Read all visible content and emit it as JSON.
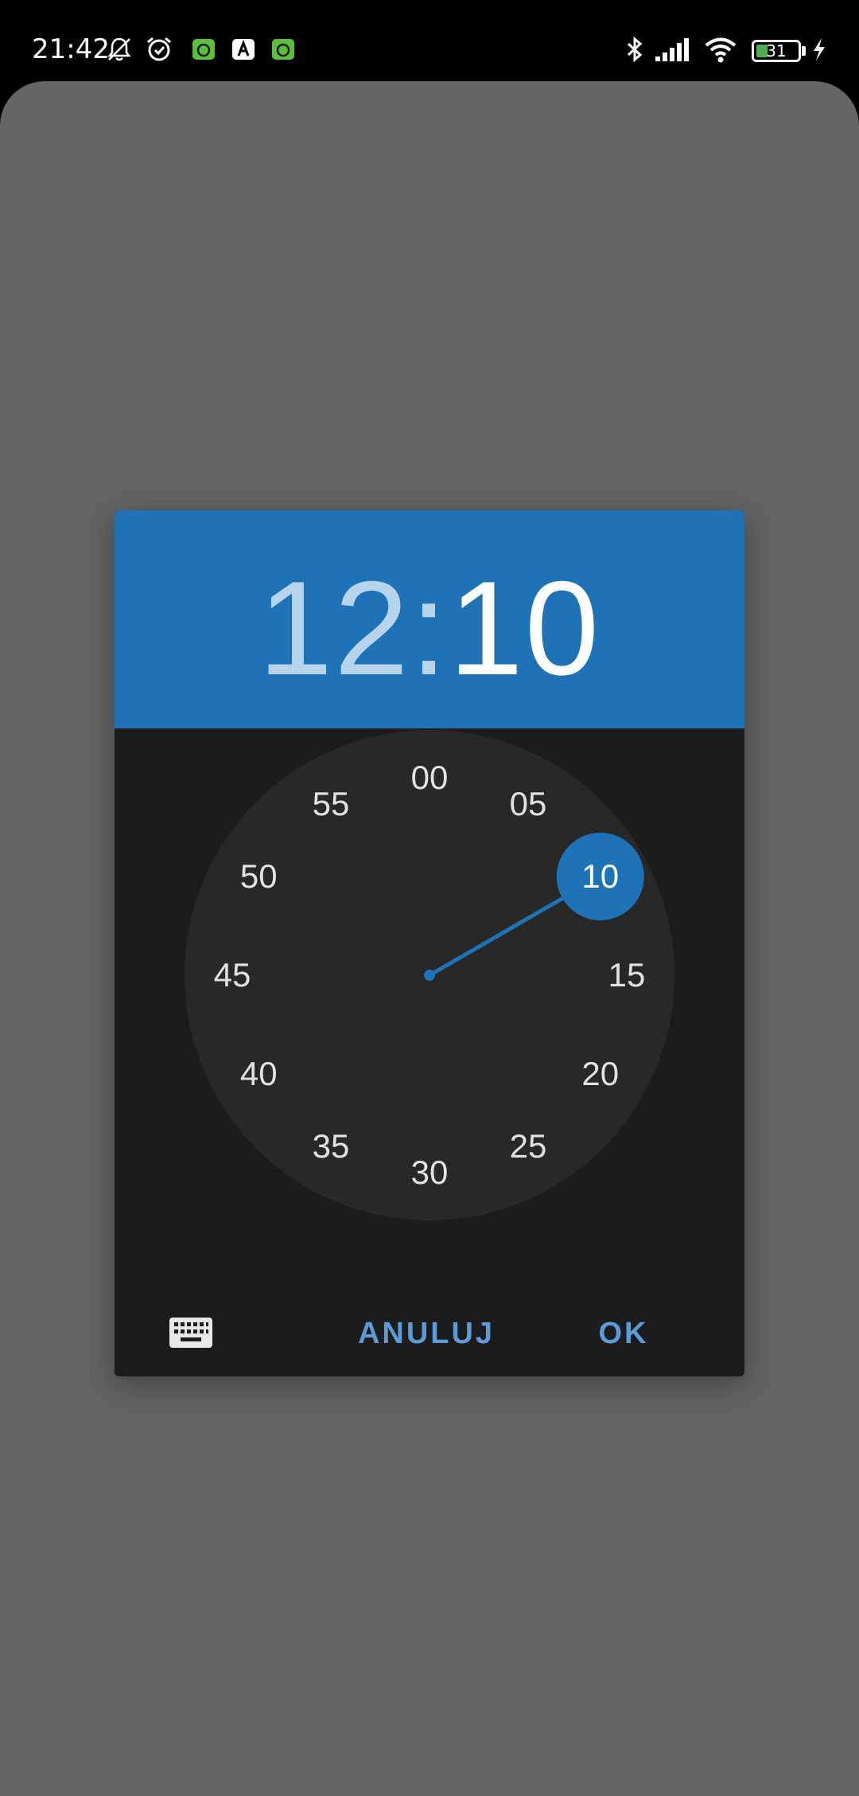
{
  "status_bar": {
    "time": "21:42",
    "battery_level": "31",
    "icons": [
      "bell-off-icon",
      "alarm-icon",
      "app-notification-icon",
      "app-notification-icon",
      "app-notification-icon",
      "bluetooth-icon",
      "signal-icon",
      "wifi-icon",
      "battery-icon",
      "charging-icon"
    ]
  },
  "dialog": {
    "hours": "12",
    "separator": ":",
    "minutes": "10",
    "clock_face": {
      "labels": [
        "00",
        "05",
        "10",
        "15",
        "20",
        "25",
        "30",
        "35",
        "40",
        "45",
        "50",
        "55"
      ],
      "selected": "10"
    },
    "keyboard_icon": "keyboard-icon",
    "cancel_label": "ANULUJ",
    "ok_label": "OK"
  },
  "colors": {
    "header": "#1e72b6",
    "accent": "#1e72b6",
    "button_text": "#5a9bd8",
    "dialog_bg": "#1c1c1c",
    "clock_face": "#282828",
    "scrim": "#636466"
  }
}
